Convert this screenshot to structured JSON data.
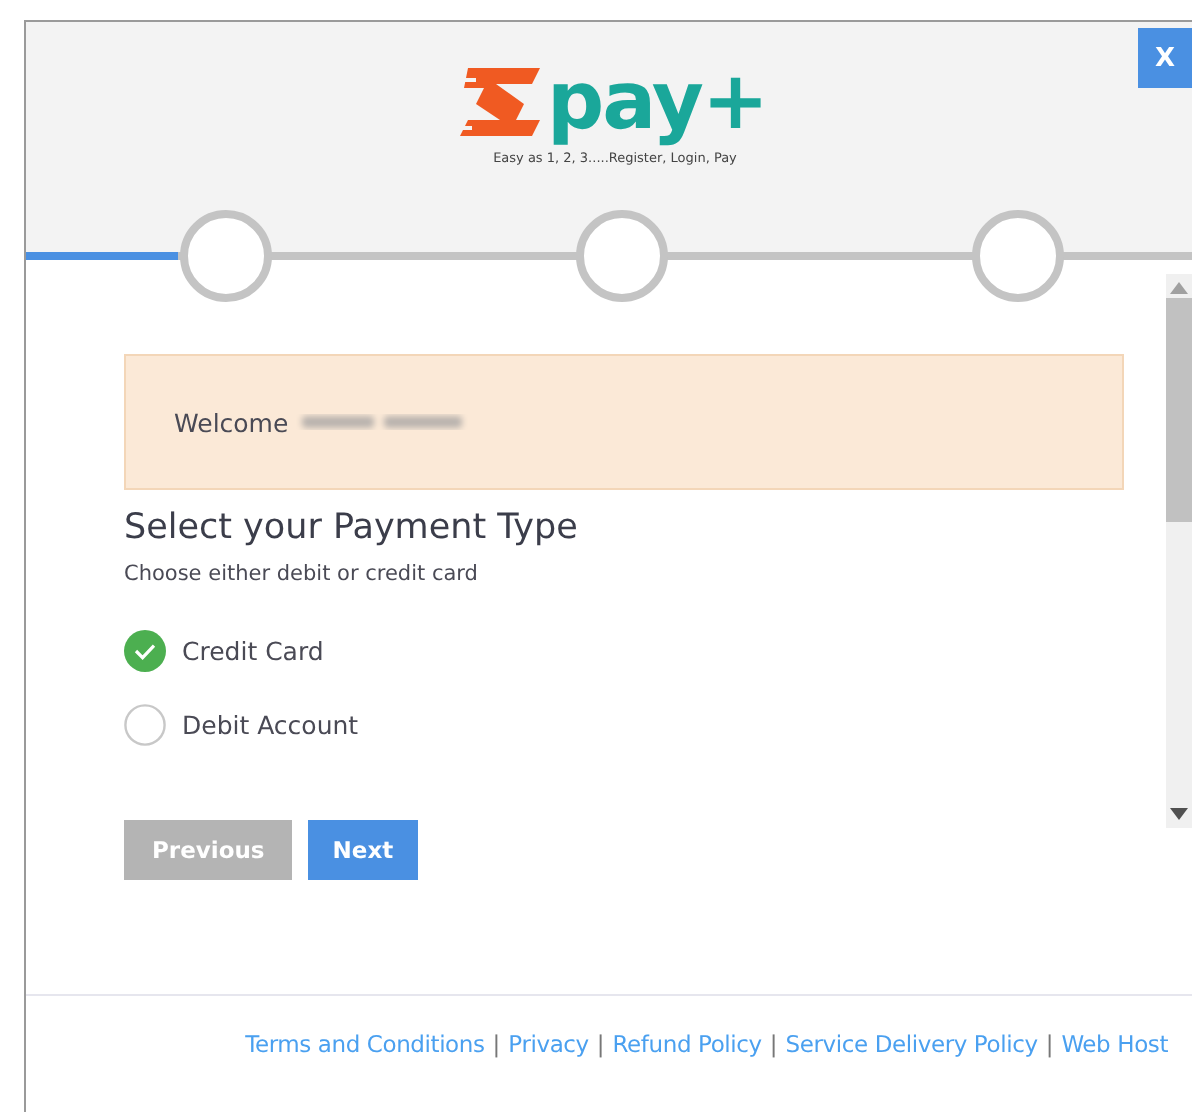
{
  "close_button": "X",
  "logo": {
    "text": "pay+",
    "tagline": "Easy as 1, 2, 3.....Register, Login, Pay"
  },
  "progress": {
    "level": 0.13,
    "steps": [
      {
        "done": false
      },
      {
        "done": false
      },
      {
        "done": false
      }
    ]
  },
  "welcome": {
    "text": "Welcome"
  },
  "title": "Select your Payment Type",
  "subtitle": "Choose either debit or credit card",
  "options": [
    {
      "label": "Credit Card",
      "selected": true
    },
    {
      "label": "Debit Account",
      "selected": false
    }
  ],
  "buttons": [
    {
      "label": "Previous",
      "disabled": true
    },
    {
      "label": "Next",
      "disabled": false
    }
  ],
  "footer": {
    "separator": "|",
    "links": [
      "Terms and Conditions",
      "Privacy",
      "Refund Policy",
      "Service Delivery Policy",
      "Web Host"
    ]
  }
}
